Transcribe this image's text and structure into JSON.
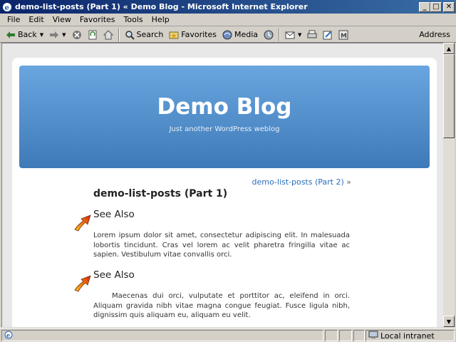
{
  "window": {
    "title": "demo-list-posts (Part 1) « Demo Blog - Microsoft Internet Explorer"
  },
  "menu": {
    "items": [
      "File",
      "Edit",
      "View",
      "Favorites",
      "Tools",
      "Help"
    ]
  },
  "toolbar": {
    "back_label": "Back",
    "search_label": "Search",
    "favorites_label": "Favorites",
    "media_label": "Media",
    "address_label": "Address"
  },
  "page": {
    "blog_title": "Demo Blog",
    "blog_description": "Just another WordPress weblog",
    "next_link": "demo-list-posts (Part 2)",
    "next_arrow": "»",
    "post_title": "demo-list-posts (Part 1)",
    "sections": [
      {
        "heading": "See Also",
        "text": "Lorem ipsum dolor sit amet, consectetur adipiscing elit. In malesuada lobortis tincidunt. Cras vel lorem ac velit pharetra fringilla vitae ac sapien. Vestibulum vitae convallis orci."
      },
      {
        "heading": "See Also",
        "text": "Maecenas dui orci, vulputate et porttitor ac, eleifend in orci. Aliquam gravida nibh vitae magna congue feugiat. Fusce ligula nibh, dignissim quis aliquam eu, aliquam eu velit."
      }
    ]
  },
  "status": {
    "zone": "Local intranet"
  },
  "colors": {
    "title_bar": "#0a246a",
    "header_blue": "#4f8fcf",
    "link": "#2a6ebb"
  }
}
